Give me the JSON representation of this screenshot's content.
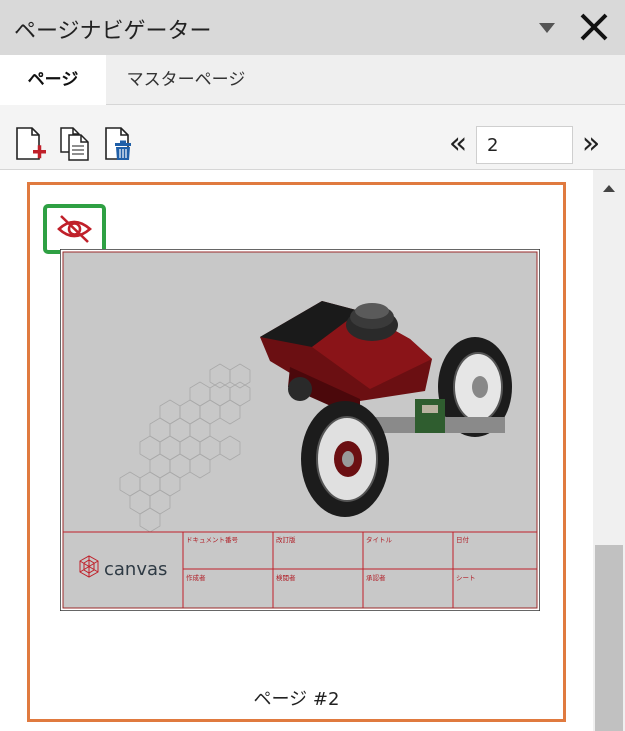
{
  "panel": {
    "title": "ページナビゲーター",
    "dropdown_icon": "triangle-down-icon",
    "close_icon": "close-icon"
  },
  "tabs": [
    {
      "label": "ページ",
      "active": true
    },
    {
      "label": "マスターページ",
      "active": false
    }
  ],
  "toolbar": {
    "add_page_icon": "add-page-icon",
    "duplicate_page_icon": "duplicate-page-icon",
    "delete_page_icon": "delete-page-icon",
    "prev_label": "«",
    "next_label": "»",
    "page_number": "2"
  },
  "page_card": {
    "visibility_icon": "eye-slash-icon",
    "label": "ページ #2",
    "thumbnail": {
      "logo_text": "canvas",
      "title_block": {
        "doc_number": "ドキュメント番号",
        "revision": "改訂版",
        "title": "タイトル",
        "date": "日付",
        "author": "作成者",
        "checker": "検閲者",
        "approver": "承認者",
        "sheet": "シート"
      }
    }
  },
  "colors": {
    "accent_orange": "#e07a3f",
    "highlight_green": "#2ea043",
    "title_block_red": "#c0202a",
    "drawing_bg": "#c8c8c8"
  }
}
